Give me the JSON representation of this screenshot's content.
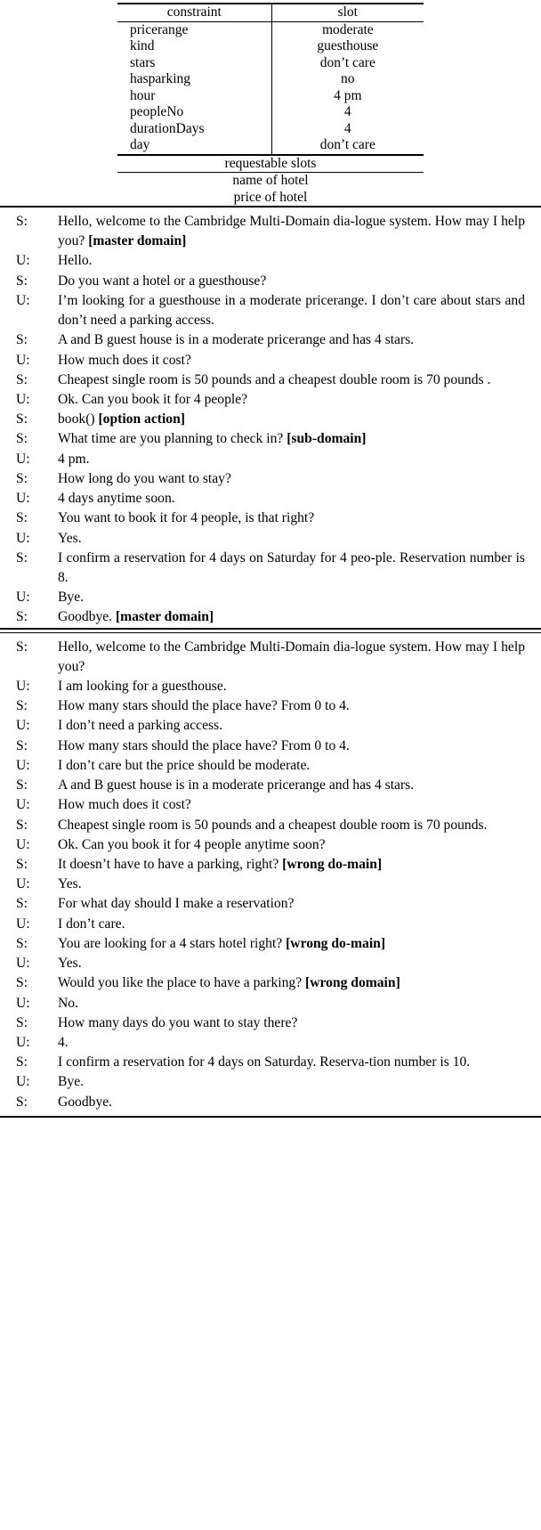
{
  "slot_table": {
    "headers": [
      "constraint",
      "slot"
    ],
    "rows": [
      [
        "pricerange",
        "moderate"
      ],
      [
        "kind",
        "guesthouse"
      ],
      [
        "stars",
        "don’t care"
      ],
      [
        "hasparking",
        "no"
      ],
      [
        "hour",
        "4 pm"
      ],
      [
        "peopleNo",
        "4"
      ],
      [
        "durationDays",
        "4"
      ],
      [
        "day",
        "don’t care"
      ]
    ],
    "requestable_header": "requestable slots",
    "requestable_slots": [
      "name of hotel",
      "price of hotel"
    ]
  },
  "dialogue_1": {
    "turns": [
      {
        "speaker": "S:",
        "text": "Hello, welcome to the Cambridge Multi-Domain dia-logue system. How may I help you? ",
        "tag": "[master domain]"
      },
      {
        "speaker": "U:",
        "text": "Hello.",
        "tag": ""
      },
      {
        "speaker": "S:",
        "text": "Do you want a hotel or a guesthouse?",
        "tag": ""
      },
      {
        "speaker": "U:",
        "text": "I’m looking for a guesthouse in a moderate pricerange. I don’t care about stars and don’t need a parking access.",
        "tag": ""
      },
      {
        "speaker": "S:",
        "text": "A and B guest house is in a moderate pricerange and has 4 stars.",
        "tag": ""
      },
      {
        "speaker": "U:",
        "text": "How much does it cost?",
        "tag": ""
      },
      {
        "speaker": "S:",
        "text": "Cheapest single room is 50 pounds and a cheapest double room is 70 pounds .",
        "tag": ""
      },
      {
        "speaker": "U:",
        "text": "Ok. Can you book it for 4 people?",
        "tag": ""
      },
      {
        "speaker": "S:",
        "text": "book() ",
        "tag": "[option action]"
      },
      {
        "speaker": "S:",
        "text": "What time are you planning to check in? ",
        "tag": "[sub-domain]"
      },
      {
        "speaker": "U:",
        "text": "4 pm.",
        "tag": ""
      },
      {
        "speaker": "S:",
        "text": "How long do you want to stay?",
        "tag": ""
      },
      {
        "speaker": "U:",
        "text": "4 days anytime soon.",
        "tag": ""
      },
      {
        "speaker": "S:",
        "text": "You want to book it for 4 people, is that right?",
        "tag": ""
      },
      {
        "speaker": "U:",
        "text": "Yes.",
        "tag": ""
      },
      {
        "speaker": "S:",
        "text": "I confirm a reservation for 4 days on Saturday for 4 peo-ple. Reservation number is 8.",
        "tag": ""
      },
      {
        "speaker": "U:",
        "text": "Bye.",
        "tag": ""
      },
      {
        "speaker": "S:",
        "text": "Goodbye. ",
        "tag": "[master domain]"
      }
    ]
  },
  "dialogue_2": {
    "turns": [
      {
        "speaker": "S:",
        "text": "Hello, welcome to the Cambridge Multi-Domain dia-logue system. How may I help you?",
        "tag": ""
      },
      {
        "speaker": "U:",
        "text": "I am looking for a guesthouse.",
        "tag": ""
      },
      {
        "speaker": "S:",
        "text": "How many stars should the place have? From 0 to 4.",
        "tag": ""
      },
      {
        "speaker": "U:",
        "text": "I don’t need a parking access.",
        "tag": ""
      },
      {
        "speaker": "S:",
        "text": "How many stars should the place have? From 0 to 4.",
        "tag": ""
      },
      {
        "speaker": "U:",
        "text": "I don’t care but the price should be moderate.",
        "tag": ""
      },
      {
        "speaker": "S:",
        "text": "A and B guest house is in a moderate pricerange and has 4 stars.",
        "tag": ""
      },
      {
        "speaker": "U:",
        "text": "How much does it cost?",
        "tag": ""
      },
      {
        "speaker": "S:",
        "text": "Cheapest single room is 50 pounds and a cheapest double room is 70 pounds.",
        "tag": ""
      },
      {
        "speaker": "U:",
        "text": "Ok. Can you book it for 4 people anytime soon?",
        "tag": ""
      },
      {
        "speaker": "S:",
        "text": "It doesn’t have to have a parking, right?  ",
        "tag": "[wrong do-main]"
      },
      {
        "speaker": "U:",
        "text": "Yes.",
        "tag": ""
      },
      {
        "speaker": "S:",
        "text": "For what day should I make a reservation?",
        "tag": ""
      },
      {
        "speaker": "U:",
        "text": "I don’t care.",
        "tag": ""
      },
      {
        "speaker": "S:",
        "text": "You are looking for a 4 stars hotel right?  ",
        "tag": "[wrong do-main]"
      },
      {
        "speaker": "U:",
        "text": "Yes.",
        "tag": ""
      },
      {
        "speaker": "S:",
        "text": "Would you like the place to have a parking?  ",
        "tag": "[wrong domain]"
      },
      {
        "speaker": "U:",
        "text": "No.",
        "tag": ""
      },
      {
        "speaker": "S:",
        "text": "How many days do you want to stay there?",
        "tag": ""
      },
      {
        "speaker": "U:",
        "text": "4.",
        "tag": ""
      },
      {
        "speaker": "S:",
        "text": "I confirm a reservation for 4 days on Saturday. Reserva-tion number is 10.",
        "tag": ""
      },
      {
        "speaker": "U:",
        "text": "Bye.",
        "tag": ""
      },
      {
        "speaker": "S:",
        "text": "Goodbye.",
        "tag": ""
      }
    ]
  }
}
